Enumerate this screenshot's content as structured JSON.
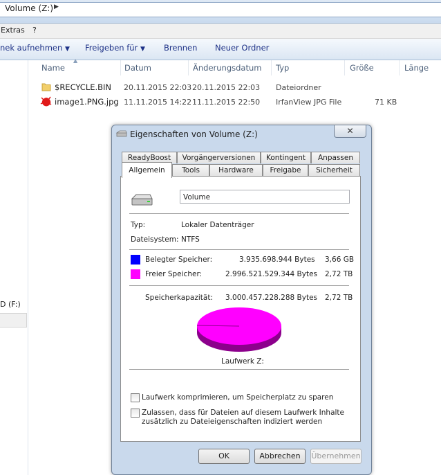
{
  "explorer": {
    "address": "Volume (Z:)",
    "menu": [
      "Extras",
      "?"
    ],
    "toolbar": [
      "nek aufnehmen",
      "Freigeben für",
      "Brennen",
      "Neuer Ordner"
    ],
    "left_pane_drive": "D (F:)",
    "columns": [
      "Name",
      "Datum",
      "Änderungsdatum",
      "Typ",
      "Größe",
      "Länge"
    ],
    "files": [
      {
        "name": "$RECYCLE.BIN",
        "date": "20.11.2015 22:03",
        "modified": "20.11.2015 22:03",
        "type": "Dateiordner",
        "size": ""
      },
      {
        "name": "image1.PNG.jpg",
        "date": "11.11.2015 14:22",
        "modified": "11.11.2015 22:50",
        "type": "IrfanView JPG File",
        "size": "71 KB"
      }
    ]
  },
  "dialog": {
    "title": "Eigenschaften von Volume (Z:)",
    "close_label": "✕",
    "tabs_top": [
      "ReadyBoost",
      "Vorgängerversionen",
      "Kontingent",
      "Anpassen"
    ],
    "tabs_bottom": [
      "Allgemein",
      "Tools",
      "Hardware",
      "Freigabe",
      "Sicherheit"
    ],
    "volume_name": "Volume",
    "type_label": "Typ:",
    "type_value": "Lokaler Datenträger",
    "fs_label": "Dateisystem:",
    "fs_value": "NTFS",
    "used_label": "Belegter Speicher:",
    "used_bytes": "3.935.698.944 Bytes",
    "used_human": "3,66 GB",
    "free_label": "Freier Speicher:",
    "free_bytes": "2.996.521.529.344 Bytes",
    "free_human": "2,72 TB",
    "cap_label": "Speicherkapazität:",
    "cap_bytes": "3.000.457.228.288 Bytes",
    "cap_human": "2,72 TB",
    "drive_label": "Laufwerk Z:",
    "compress_label": "Laufwerk komprimieren, um Speicherplatz zu sparen",
    "index_label_1": "Zulassen, dass für Dateien auf diesem Laufwerk Inhalte",
    "index_label_2": "zusätzlich zu Dateieigenschaften indiziert werden",
    "compress_checked": false,
    "index_checked": false,
    "ok_label": "OK",
    "cancel_label": "Abbrechen",
    "apply_label": "Übernehmen",
    "colors": {
      "used": "#0000ff",
      "free": "#ff00ff",
      "free_side": "#8c008c"
    }
  }
}
